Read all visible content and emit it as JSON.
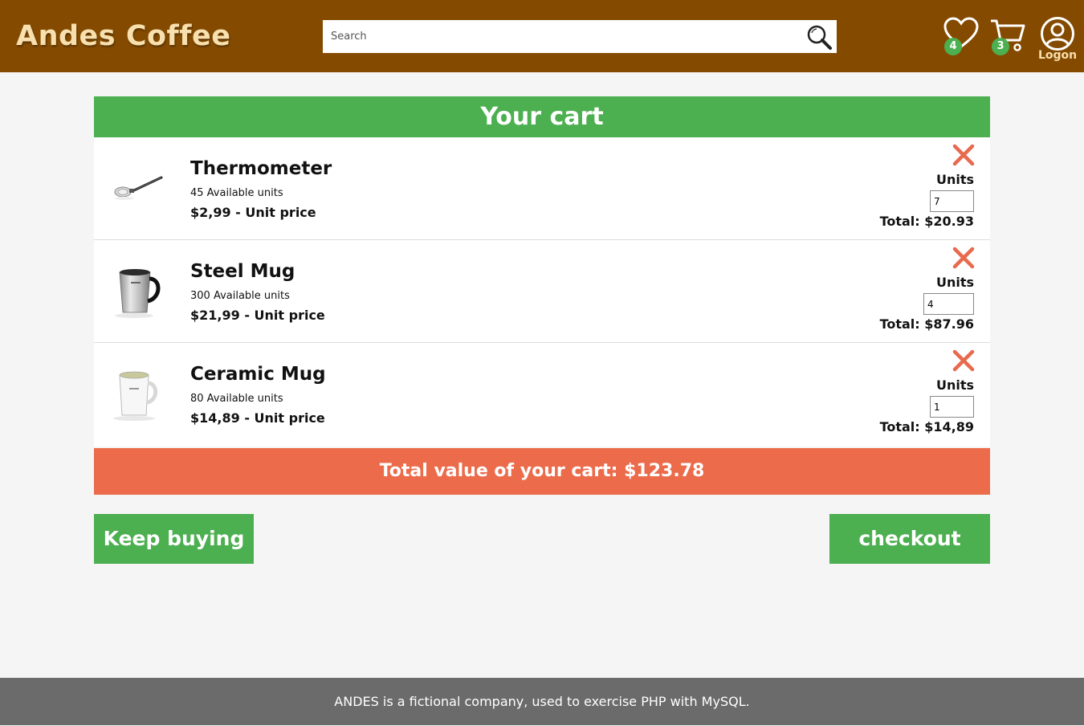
{
  "header": {
    "brand": "Andes Coffee",
    "search_placeholder": "Search",
    "wishlist_count": "4",
    "cart_count": "3",
    "logon_label": "Logon"
  },
  "cart": {
    "title": "Your cart",
    "units_label": "Units",
    "items": [
      {
        "name": "Thermometer",
        "available": "45 Available units",
        "price": "$2,99 - Unit price",
        "quantity": "7",
        "total": "Total: $20.93"
      },
      {
        "name": "Steel Mug",
        "available": "300 Available units",
        "price": "$21,99 - Unit price",
        "quantity": "4",
        "total": "Total: $87.96"
      },
      {
        "name": "Ceramic Mug",
        "available": "80 Available units",
        "price": "$14,89 - Unit price",
        "quantity": "1",
        "total": "Total: $14,89"
      }
    ],
    "grand_total": "Total value of your cart: $123.78",
    "keep_buying_label": "Keep buying",
    "checkout_label": "checkout"
  },
  "footer": {
    "text": "ANDES is a fictional company, used to exercise PHP with MySQL."
  },
  "colors": {
    "header_bg": "#844b00",
    "brand_text": "#f8dfae",
    "primary_green": "#4caf50",
    "total_bar": "#eb6b4b",
    "remove_icon": "#e86a4e",
    "footer_bg": "#6b6b6b",
    "page_bg": "#f5f5f5"
  },
  "icons": {
    "search": "search-icon",
    "wishlist": "heart-icon",
    "cart": "cart-icon",
    "logon": "user-icon",
    "remove": "close-icon"
  }
}
